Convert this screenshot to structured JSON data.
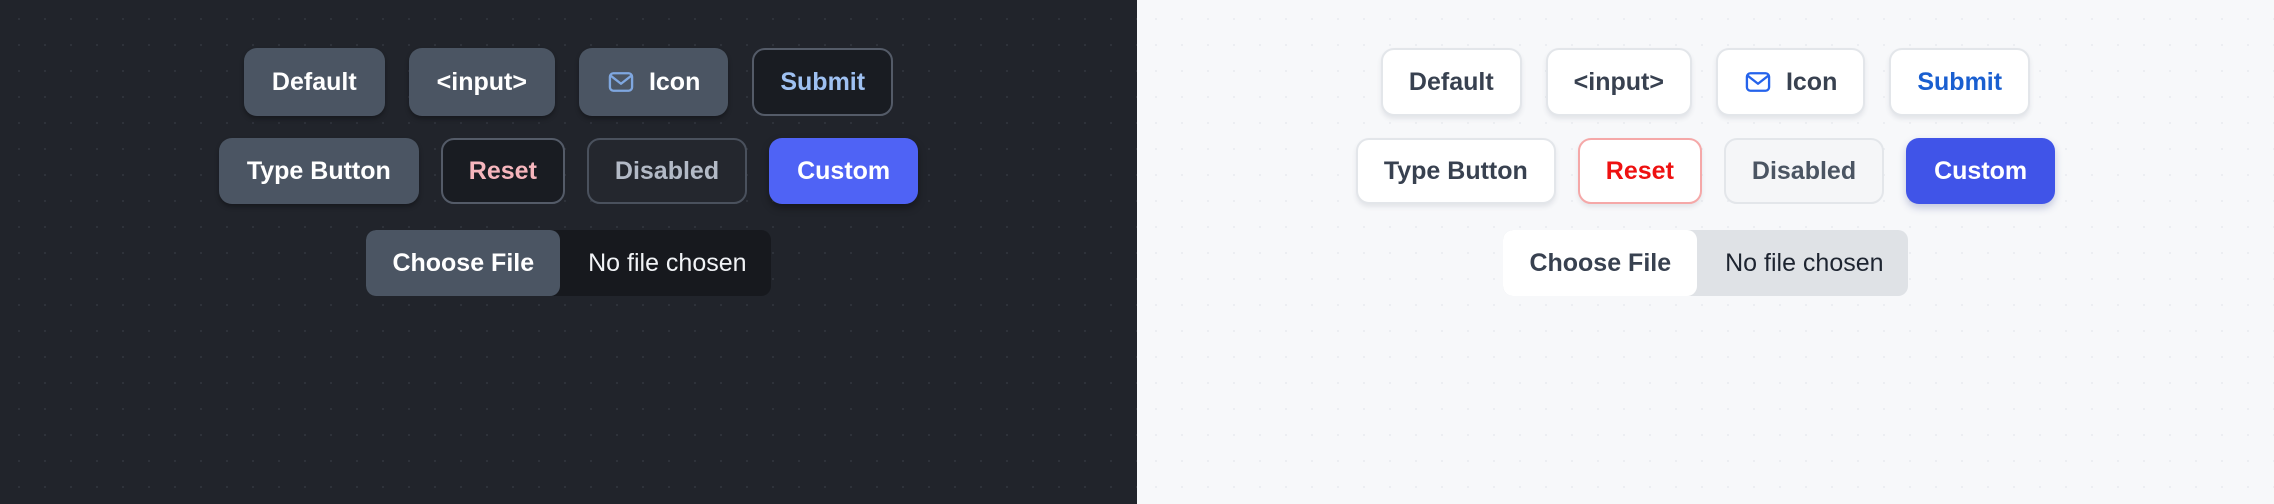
{
  "panels": [
    {
      "theme": "dark",
      "background": "#21242b",
      "row1": [
        {
          "label": "Default",
          "name": "default-button"
        },
        {
          "label": "<input>",
          "name": "input-button"
        },
        {
          "label": "Icon",
          "name": "icon-button",
          "icon": "envelope-icon"
        },
        {
          "label": "Submit",
          "name": "submit-button"
        }
      ],
      "row2": [
        {
          "label": "Type Button",
          "name": "type-button"
        },
        {
          "label": "Reset",
          "name": "reset-button"
        },
        {
          "label": "Disabled",
          "name": "disabled-button"
        },
        {
          "label": "Custom",
          "name": "custom-button"
        }
      ],
      "file": {
        "button_label": "Choose File",
        "status": "No file chosen"
      },
      "colors": {
        "button_bg": "#4b5563",
        "button_text": "#ffffff",
        "submit_text": "#9fc1f2",
        "reset_text": "#f6b6bd",
        "disabled_text": "#b3bac6",
        "custom_bg": "#4f63f5",
        "custom_text": "#ffffff",
        "icon": "#7fa7e0",
        "file_track": "#17191e"
      }
    },
    {
      "theme": "light",
      "background": "#f7f8fa",
      "row1": [
        {
          "label": "Default",
          "name": "default-button"
        },
        {
          "label": "<input>",
          "name": "input-button"
        },
        {
          "label": "Icon",
          "name": "icon-button",
          "icon": "envelope-icon"
        },
        {
          "label": "Submit",
          "name": "submit-button"
        }
      ],
      "row2": [
        {
          "label": "Type Button",
          "name": "type-button"
        },
        {
          "label": "Reset",
          "name": "reset-button"
        },
        {
          "label": "Disabled",
          "name": "disabled-button"
        },
        {
          "label": "Custom",
          "name": "custom-button"
        }
      ],
      "file": {
        "button_label": "Choose File",
        "status": "No file chosen"
      },
      "colors": {
        "button_bg": "#ffffff",
        "button_text": "#384150",
        "submit_text": "#1a5fd0",
        "reset_text": "#ee1111",
        "reset_border": "#f5a8a8",
        "disabled_text": "#4b5563",
        "custom_bg": "#4054e8",
        "custom_text": "#ffffff",
        "icon": "#2563eb",
        "file_track": "#dfe2e6"
      }
    }
  ]
}
